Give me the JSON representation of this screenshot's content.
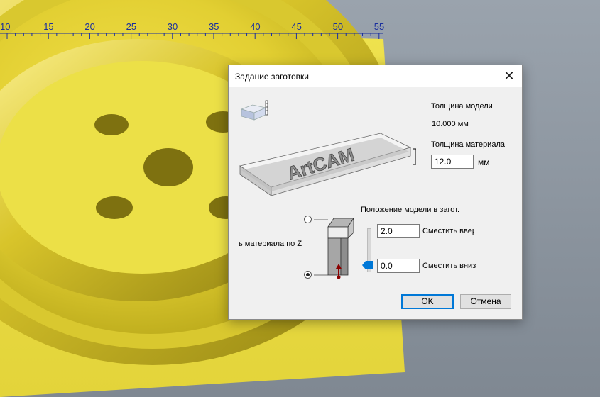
{
  "ruler": {
    "ticks": [
      "10",
      "15",
      "20",
      "25",
      "30",
      "35",
      "40",
      "45",
      "50",
      "55"
    ]
  },
  "dialog": {
    "title": "Задание заготовки",
    "model_thickness_label": "Толщина модели",
    "model_thickness_value": "10.000 мм",
    "material_thickness_label": "Толщина материала",
    "material_thickness_value": "12.0",
    "material_thickness_unit": "мм",
    "illustration_text": "ArtCAM",
    "model_position_label": "Положение модели в загот.",
    "z_zero_label": "ь материала по Z",
    "offset_up_value": "2.0",
    "offset_up_label": "Сместить вверх",
    "offset_down_value": "0.0",
    "offset_down_label": "Сместить вниз",
    "ok_label": "OK",
    "cancel_label": "Отмена"
  },
  "colors": {
    "accent": "#0078d7",
    "model_yellow": "#e8d63a",
    "ruler_text": "#1a2f9e"
  }
}
